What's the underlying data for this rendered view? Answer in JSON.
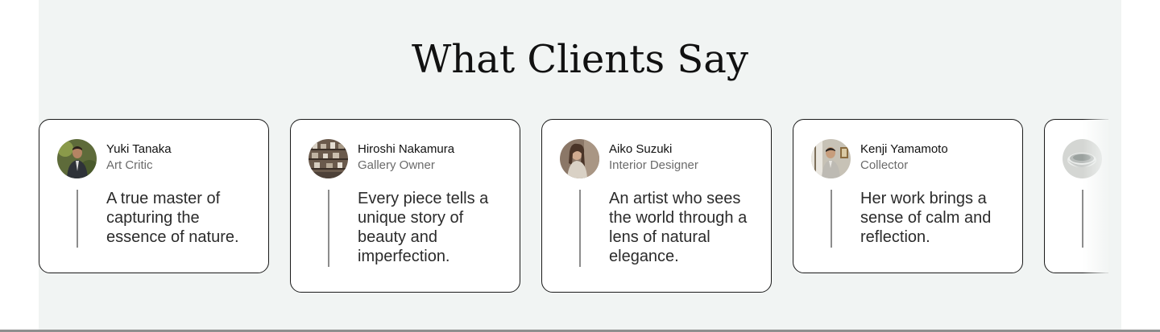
{
  "section": {
    "title": "What Clients Say"
  },
  "testimonials": [
    {
      "name": "Yuki Tanaka",
      "role": "Art Critic",
      "quote": "A true master of capturing the essence of nature.",
      "avatar_icon": "portrait-man-suit-icon"
    },
    {
      "name": "Hiroshi Nakamura",
      "role": "Gallery Owner",
      "quote": "Every piece tells a unique story of beauty and imperfection.",
      "avatar_icon": "pottery-shelves-icon"
    },
    {
      "name": "Aiko Suzuki",
      "role": "Interior Designer",
      "quote": "An artist who sees the world through a lens of natural elegance.",
      "avatar_icon": "portrait-woman-icon"
    },
    {
      "name": "Kenji Yamamoto",
      "role": "Collector",
      "quote": "Her work brings a sense of calm and reflection.",
      "avatar_icon": "portrait-man-window-icon"
    },
    {
      "name": "",
      "role": "",
      "quote": "",
      "avatar_icon": "ceramic-bowl-icon"
    }
  ],
  "colors": {
    "section_background": "#f1f4f3",
    "card_border": "#1a1a1a",
    "quote_rule": "#8c8c8c",
    "role_text": "#6b6b6b"
  }
}
